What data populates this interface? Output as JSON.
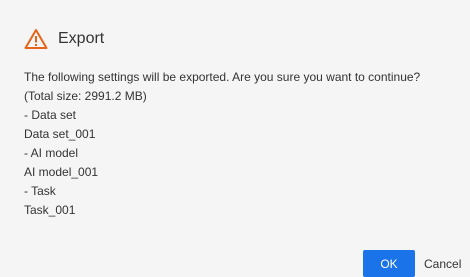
{
  "dialog": {
    "title": "Export",
    "icon": "warning-triangle-icon",
    "accent_color": "#e8641b",
    "lines": [
      "The following settings will be exported. Are you sure you want to continue?",
      "(Total size: 2991.2 MB)",
      "- Data set",
      "Data set_001",
      "- AI model",
      "AI model_001",
      "- Task",
      "Task_001"
    ]
  },
  "buttons": {
    "ok_label": "OK",
    "cancel_label": "Cancel",
    "ok_color": "#1a73e8"
  }
}
